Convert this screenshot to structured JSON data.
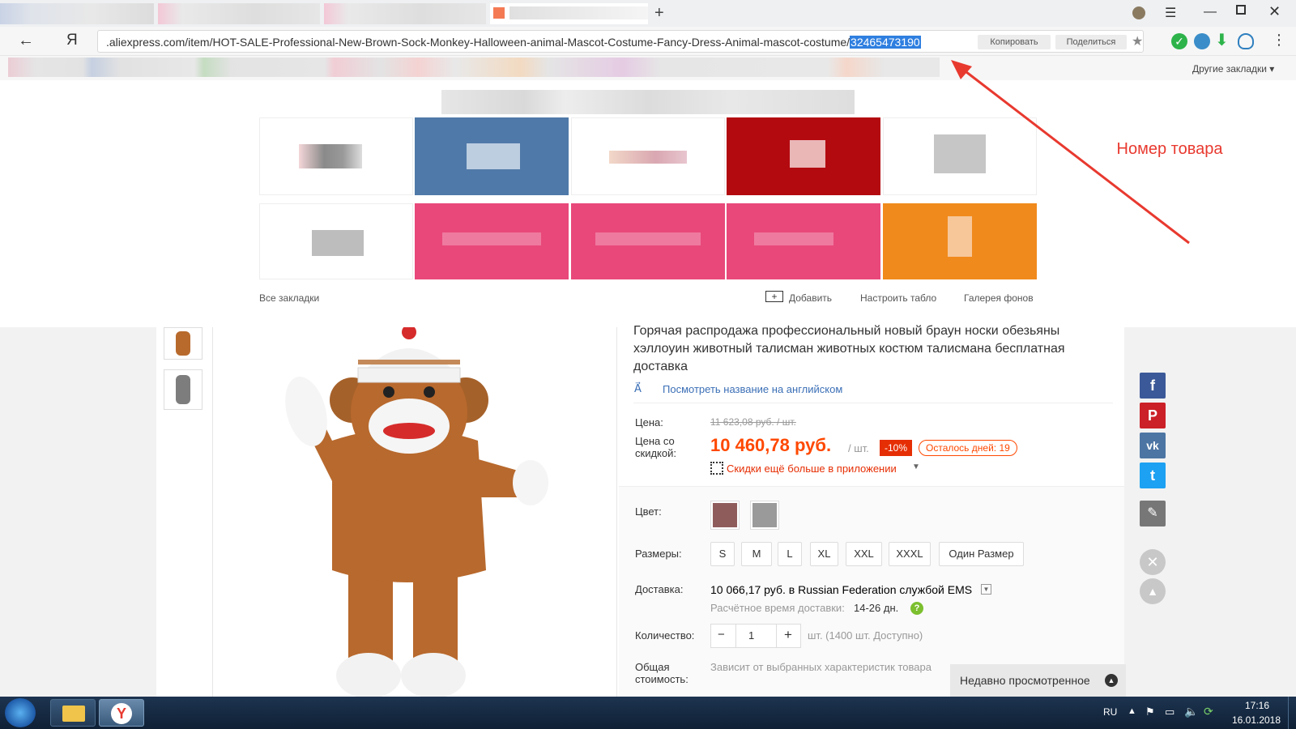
{
  "browser": {
    "url_prefix": ".aliexpress.com/item/HOT-SALE-Professional-New-Brown-Sock-Monkey-Halloween-animal-Mascot-Costume-Fancy-Dress-Animal-mascot-costume/",
    "url_selected": "32465473190",
    "copy_button": "Копировать",
    "share_button": "Поделиться",
    "yandex_logo": "Я",
    "other_bookmarks": "Другие закладки ▾",
    "new_tab": "+"
  },
  "tableau": {
    "all_bookmarks": "Все закладки",
    "add": "Добавить",
    "customize": "Настроить табло",
    "gallery": "Галерея фонов",
    "colors": [
      "#ffffff",
      "#4f79a8",
      "#ffffff",
      "#b30a10",
      "#ffffff",
      "#ffffff",
      "#e8487a",
      "#e8487a",
      "#e8487a",
      "#f08a1c"
    ]
  },
  "annotation": {
    "label": "Номер товара",
    "color": "#e8392f"
  },
  "product": {
    "title": "Горячая распродажа профессиональный новый браун носки обезьяны хэллоуин животный талисман животных костюм талисмана бесплатная доставка",
    "view_english": "Посмотреть название на английском",
    "price_label": "Цена:",
    "old_price": "11 623,08 руб. / шт.",
    "discount_label": "Цена со скидкой:",
    "price": "10 460,78 руб.",
    "per_unit": "/ шт.",
    "discount_badge": "-10%",
    "days_left": "Осталось дней: 19",
    "app_discount": "Скидки ещё больше в приложении",
    "color_label": "Цвет:",
    "colors": [
      "#8f5c5c",
      "#9a9a9a"
    ],
    "sizes_label": "Размеры:",
    "sizes": [
      "S",
      "M",
      "L",
      "XL",
      "XXL",
      "XXXL",
      "Один Размер"
    ],
    "delivery_label": "Доставка:",
    "delivery_price": "10 066,17 руб.",
    "delivery_to": " в Russian Federation службой EMS",
    "delivery_time_label": "Расчётное время доставки:",
    "delivery_time": "14-26 дн.",
    "qty_label": "Количество:",
    "qty_value": "1",
    "qty_minus": "−",
    "qty_plus": "+",
    "qty_available": "шт. (1400 шт. Доступно)",
    "total_label": "Общая стоимость:",
    "total_value": "Зависит от выбранных характеристик товара",
    "recent": "Недавно просмотренное",
    "price_color": "#ff4800"
  },
  "social": [
    {
      "name": "facebook",
      "glyph": "f",
      "color": "#3b5998"
    },
    {
      "name": "pinterest",
      "glyph": "P",
      "color": "#cb2027"
    },
    {
      "name": "vk",
      "glyph": "vk",
      "color": "#4c75a3"
    },
    {
      "name": "twitter",
      "glyph": "t",
      "color": "#1da1f2"
    }
  ],
  "taskbar": {
    "lang": "RU",
    "time": "17:16",
    "date": "16.01.2018"
  }
}
